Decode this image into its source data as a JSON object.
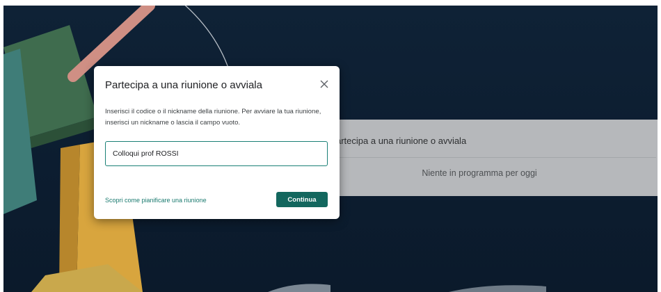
{
  "background": {
    "join_card_title": "artecipa a una riunione o avviala",
    "empty_schedule_text": "Niente in programma per oggi"
  },
  "dialog": {
    "title": "Partecipa a una riunione o avviala",
    "close_icon": "close-icon",
    "description": "Inserisci il codice o il nickname della riunione. Per avviare la tua riunione, inserisci un nickname o lascia il campo vuoto.",
    "input_value": "Colloqui prof ROSSI",
    "learn_link": "Scopri come pianificare una riunione",
    "continue_label": "Continua"
  },
  "colors": {
    "accent": "#13675e",
    "link": "#1a7a6f",
    "background": "#0f2236"
  }
}
